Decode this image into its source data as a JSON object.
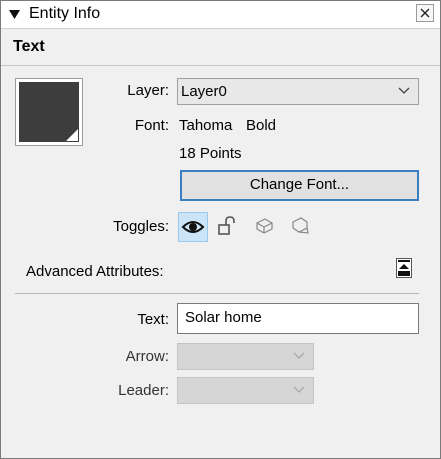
{
  "window": {
    "title": "Entity Info"
  },
  "section": {
    "title": "Text"
  },
  "fields": {
    "layer_label": "Layer:",
    "layer_value": "Layer0",
    "font_label": "Font:",
    "font_name": "Tahoma",
    "font_style": "Bold",
    "font_size": "18 Points",
    "change_font_button": "Change Font...",
    "toggles_label": "Toggles:",
    "advanced_label": "Advanced Attributes:",
    "text_label": "Text:",
    "text_value": "Solar home",
    "arrow_label": "Arrow:",
    "arrow_value": "",
    "leader_label": "Leader:",
    "leader_value": ""
  },
  "toggles": [
    {
      "icon": "eye-icon",
      "active": true
    },
    {
      "icon": "lock-icon",
      "active": false
    },
    {
      "icon": "shadow-receive-icon",
      "active": false
    },
    {
      "icon": "shadow-cast-icon",
      "active": false
    }
  ],
  "colors": {
    "swatch": "#3d3d3d",
    "focus_border": "#3a7fc1",
    "toggle_active": "#cce4f7"
  }
}
